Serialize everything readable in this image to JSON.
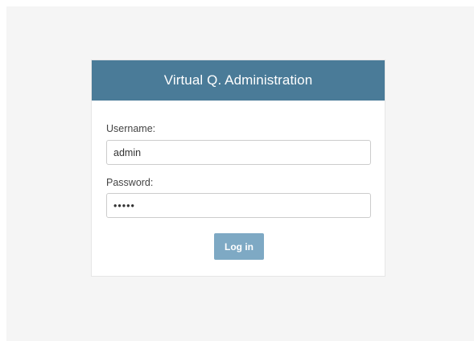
{
  "login": {
    "title": "Virtual Q. Administration",
    "username_label": "Username:",
    "username_value": "admin",
    "password_label": "Password:",
    "password_value": "•••••",
    "submit_label": "Log in"
  },
  "colors": {
    "header_bg": "#4a7b98",
    "button_bg": "#7ea9c4",
    "page_bg": "#f5f5f5"
  }
}
